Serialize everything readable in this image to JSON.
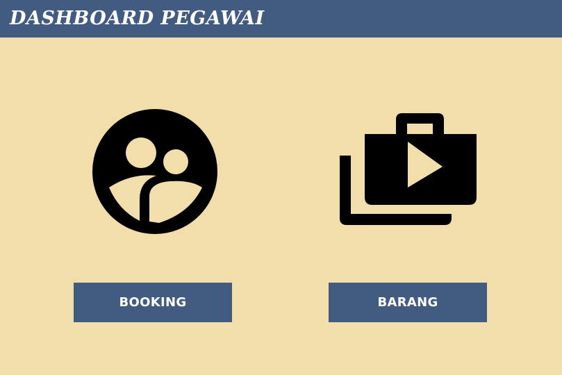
{
  "header": {
    "title": "DASHBOARD PEGAWAI"
  },
  "menu": [
    {
      "label": "BOOKING",
      "icon": "group-circle-icon"
    },
    {
      "label": "BARANG",
      "icon": "work-history-icon"
    }
  ],
  "colors": {
    "background": "#f2deab",
    "header": "#425b80",
    "button": "#425b80",
    "icon": "#000000",
    "text_light": "#ffffff"
  }
}
